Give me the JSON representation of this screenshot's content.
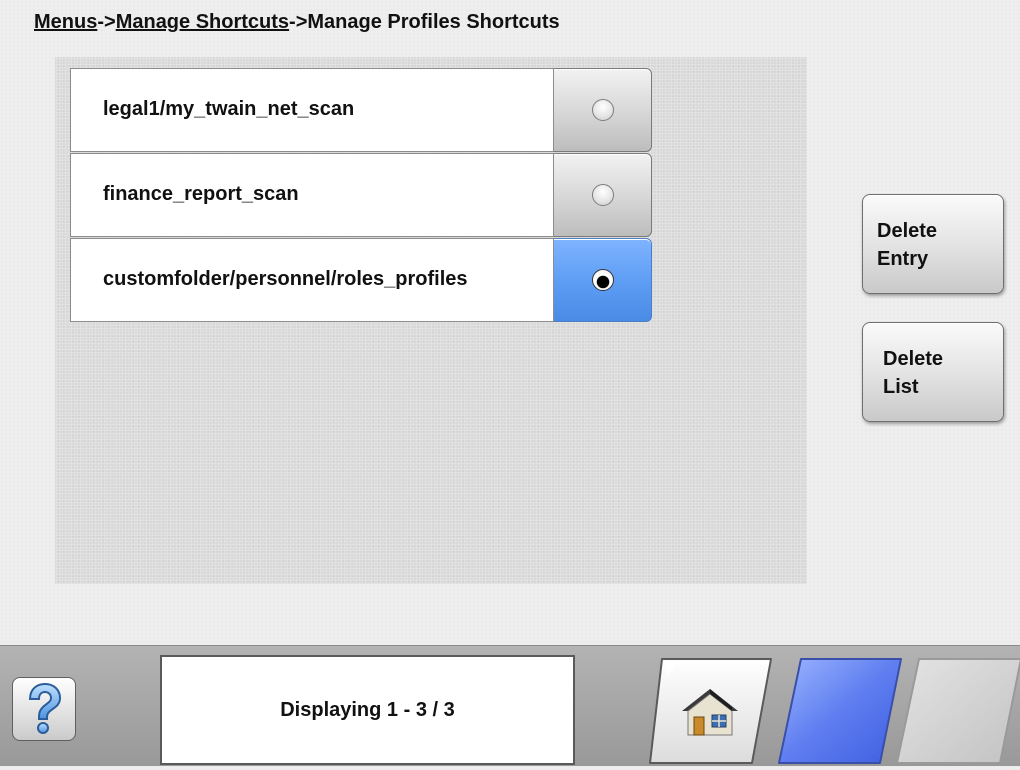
{
  "breadcrumb": {
    "items": [
      {
        "label": "Menus",
        "link": true
      },
      {
        "label": "->",
        "link": false
      },
      {
        "label": "Manage Shortcuts",
        "link": true
      },
      {
        "label": "->Manage Profiles Shortcuts",
        "link": false
      }
    ]
  },
  "list": {
    "rows": [
      {
        "label": "legal1/my_twain_net_scan",
        "selected": false
      },
      {
        "label": "finance_report_scan",
        "selected": false
      },
      {
        "label": "customfolder/personnel/roles_profiles",
        "selected": true
      }
    ]
  },
  "side_buttons": {
    "delete_entry": {
      "line1": "Delete",
      "line2": "Entry"
    },
    "delete_list": {
      "line1": "Delete",
      "line2": "List"
    }
  },
  "bottom_bar": {
    "help_icon": "question-mark-icon",
    "status_text": "Displaying 1 - 3 / 3",
    "home_icon": "home-icon",
    "nav_back_icon": "blue-parallelogram-icon",
    "nav_forward_icon": "gray-parallelogram-icon"
  },
  "colors": {
    "selected_accent": "#5c9cf3",
    "panel_bg": "#d9d9d9"
  }
}
